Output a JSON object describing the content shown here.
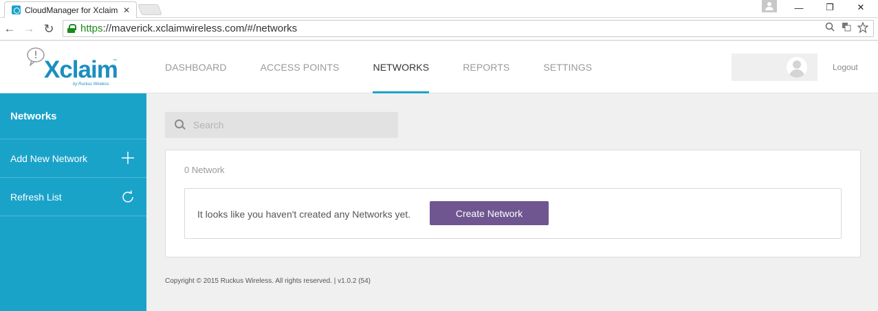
{
  "browser": {
    "tab_title": "CloudManager for Xclaim",
    "tab_close": "✕",
    "url_https": "https",
    "url_rest": "://maverick.xclaimwireless.com/#/networks",
    "window_controls": {
      "minimize": "—",
      "maximize": "❐",
      "close": "✕"
    },
    "nav": {
      "back": "←",
      "forward": "→",
      "reload": "↻"
    },
    "address_icons": [
      "zoom-icon",
      "translate-icon",
      "star-icon"
    ]
  },
  "header": {
    "logo_text": "Xclaim",
    "logo_tm": "™",
    "logo_sub": "by Ruckus Wireless",
    "nav_items": [
      {
        "label": "DASHBOARD",
        "active": false
      },
      {
        "label": "ACCESS POINTS",
        "active": false
      },
      {
        "label": "NETWORKS",
        "active": true
      },
      {
        "label": "REPORTS",
        "active": false
      },
      {
        "label": "SETTINGS",
        "active": false
      }
    ],
    "logout_label": "Logout"
  },
  "sidebar": {
    "title": "Networks",
    "items": [
      {
        "label": "Add New Network",
        "icon": "plus-icon"
      },
      {
        "label": "Refresh List",
        "icon": "refresh-icon"
      }
    ]
  },
  "main": {
    "search": {
      "placeholder": "Search",
      "value": ""
    },
    "count_label": "0 Network",
    "empty_message": "It looks like you haven't created any Networks yet.",
    "create_button_label": "Create Network",
    "footer": "Copyright © 2015 Ruckus Wireless. All rights reserved. | v1.0.2 (54)"
  },
  "colors": {
    "accent": "#1aa3c9",
    "button": "#6f5690",
    "logo": "#1a8fc0"
  }
}
